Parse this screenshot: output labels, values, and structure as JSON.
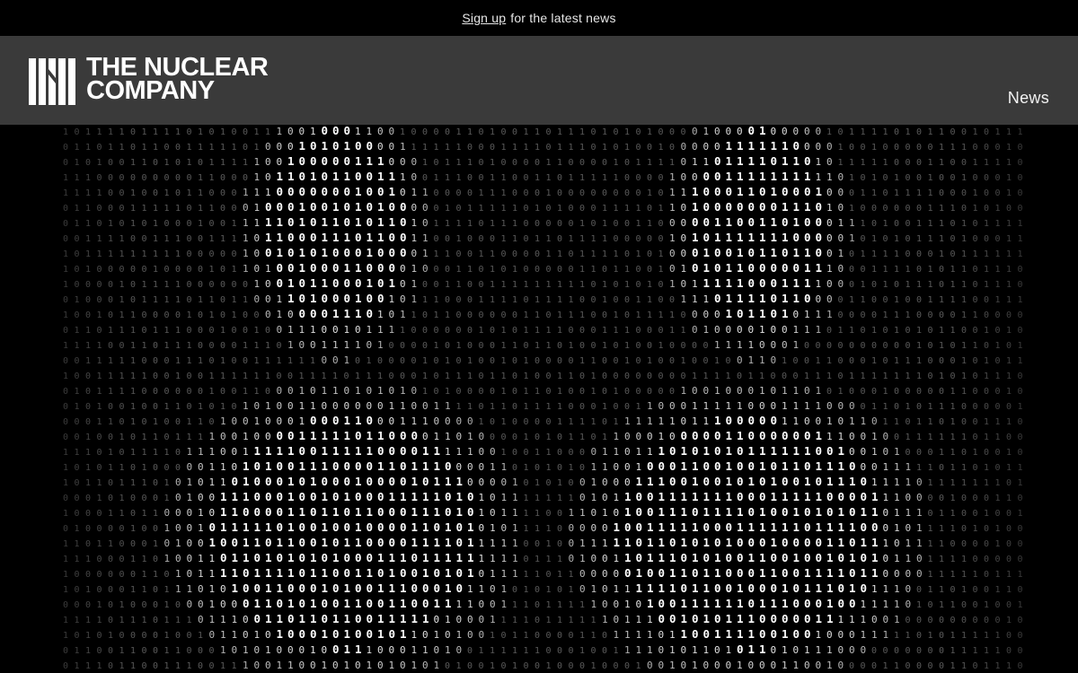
{
  "announcement": {
    "link_label": "Sign up",
    "text": "for the latest news"
  },
  "header": {
    "logo_line1": "THE NUCLEAR",
    "logo_line2": "COMPANY",
    "nav": [
      {
        "label": "News"
      }
    ]
  },
  "hero": {
    "glyphs": [
      "0",
      "1"
    ],
    "background": "#000000",
    "foreground": "#ffffff",
    "header_color": "#3a3a3a"
  }
}
